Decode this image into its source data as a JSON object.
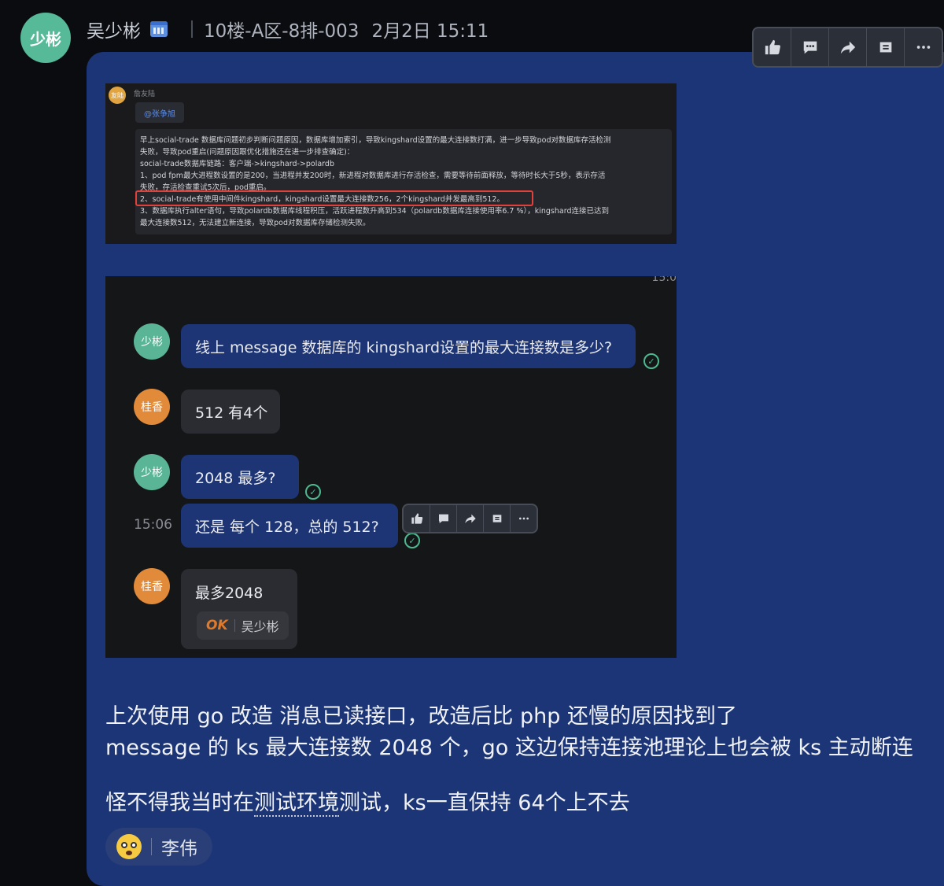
{
  "header": {
    "avatar_text": "少彬",
    "sender_name": "吴少彬",
    "location": "10楼-A区-8排-003",
    "time": "2月2日 15:11"
  },
  "toolbar": {
    "icons": [
      "thumbs-up-icon",
      "comment-icon",
      "forward-icon",
      "pin-icon",
      "more-icon"
    ]
  },
  "screenshot1": {
    "avatar_text": "友陆",
    "name": "詹友陆",
    "mention": "@张争旭",
    "lines": [
      "早上social-trade 数据库问题初步判断问题原因，数据库增加索引，导致kingshard设置的最大连接数打满，进一步导致pod对数据库存活检测",
      "失败，导致pod重启(问题原因跟优化措施还在进一步排查确定)：",
      "social-trade数据库链路：客户端->kingshard->polardb",
      "1、pod fpm最大进程数设置的是200，当进程并发200时，新进程对数据库进行存活检查，需要等待前面释放，等待时长大于5秒，表示存活",
      "失败，存活检查重试5次后，pod重启。",
      "2、social-trade有使用中间件kingshard，kingshard设置最大连接数256，2个kingshard并发最高到512。",
      "3、数据库执行alter语句，导致polardb数据库线程积压，活跃进程数升高到534（polardb数据库连接使用率6.7 %），kingshard连接已达到",
      "最大连接数512，无法建立新连接，导致pod对数据库存储检测失败。"
    ]
  },
  "screenshot2": {
    "top_clip": "15:0",
    "timestamp": "15:06",
    "messages": [
      {
        "avatar": "少彬",
        "text": "线上 message 数据库的 kingshard设置的最大连接数是多少?"
      },
      {
        "avatar": "桂香",
        "text": "512 有4个"
      },
      {
        "avatar": "少彬",
        "text": "2048 最多?"
      },
      {
        "text": "还是 每个 128，总的 512?"
      },
      {
        "avatar": "桂香",
        "text": "最多2048"
      }
    ],
    "reaction": {
      "ok": "OK",
      "user": "吴少彬"
    }
  },
  "message": {
    "line1": "上次使用 go 改造 消息已读接口，改造后比 php 还慢的原因找到了",
    "line2": "message 的 ks 最大连接数 2048 个，go 这边保持连接池理论上也会被 ks 主动断连",
    "line3_pre": "怪不得我当时在",
    "line3_link": "测试环境",
    "line3_post": "测试，ks一直保持 64个上不去"
  },
  "bottom_reaction": {
    "emoji": "astonished-face",
    "user": "李伟"
  }
}
